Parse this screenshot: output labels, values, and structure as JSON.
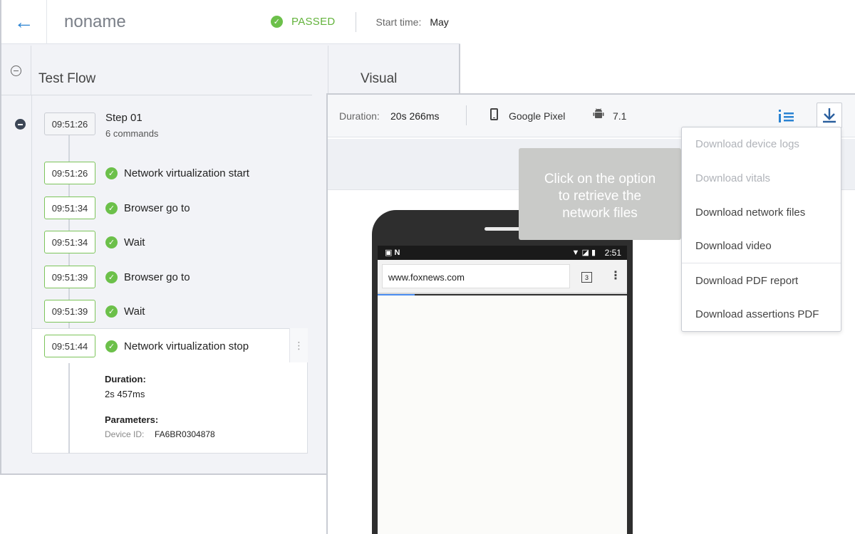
{
  "header": {
    "back_icon": "arrow-left-icon",
    "title": "noname",
    "status": "PASSED",
    "start_time_label": "Start time:",
    "start_time_value": "May"
  },
  "panels": {
    "test_flow_title": "Test Flow",
    "visual_title": "Visual"
  },
  "step": {
    "time": "09:51:26",
    "name": "Step 01",
    "sub": "6 commands"
  },
  "commands": [
    {
      "time": "09:51:26",
      "label": "Network virtualization start"
    },
    {
      "time": "09:51:34",
      "label": "Browser go to"
    },
    {
      "time": "09:51:34",
      "label": "Wait"
    },
    {
      "time": "09:51:39",
      "label": "Browser go to"
    },
    {
      "time": "09:51:39",
      "label": "Wait"
    },
    {
      "time": "09:51:44",
      "label": "Network virtualization stop"
    }
  ],
  "details": {
    "duration_label": "Duration:",
    "duration_value": "2s 457ms",
    "parameters_label": "Parameters:",
    "device_id_key": "Device ID:",
    "device_id_value": "FA6BR0304878"
  },
  "visual": {
    "duration_label": "Duration:",
    "duration_value": "20s 266ms",
    "device_name": "Google Pixel",
    "os_version": "7.1"
  },
  "phone": {
    "status_left": "▣ N",
    "status_icons": "▼ ◪ ▮",
    "time": "2:51",
    "url": "www.foxnews.com",
    "tab_count": "3"
  },
  "dropdown": {
    "items": [
      {
        "label": "Download device logs",
        "disabled": true
      },
      {
        "label": "Download vitals",
        "disabled": true
      },
      {
        "label": "Download network files",
        "disabled": false
      },
      {
        "label": "Download video",
        "disabled": false
      },
      {
        "label": "Download PDF report",
        "disabled": false
      },
      {
        "label": "Download assertions PDF",
        "disabled": false
      }
    ]
  },
  "tooltip": {
    "text_line1": "Click on the option",
    "text_line2": "to retrieve the",
    "text_line3": "network files"
  },
  "colors": {
    "accent": "#2a83d2",
    "success": "#6cc04a",
    "tooltip_bg": "#c9cac8"
  }
}
